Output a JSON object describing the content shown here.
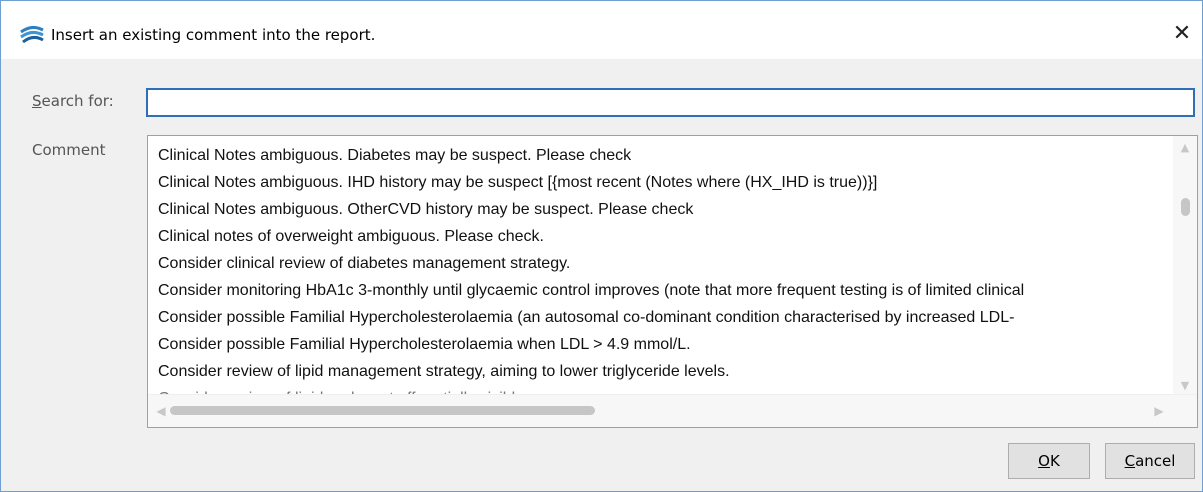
{
  "window": {
    "title": "Insert an existing comment into the report.",
    "close_glyph": "✕",
    "icon": "app-logo-icon"
  },
  "search": {
    "label_mnemonic": "S",
    "label_rest": "earch for:",
    "value": "",
    "placeholder": ""
  },
  "comment": {
    "label": "Comment",
    "items": [
      "Clinical Notes ambiguous. Diabetes may be suspect. Please check",
      "Clinical Notes ambiguous. IHD history may be suspect [{most recent (Notes where (HX_IHD is true))}]",
      "Clinical Notes ambiguous. OtherCVD history may be suspect. Please check",
      "Clinical notes of overweight ambiguous. Please check.",
      "Consider clinical review of diabetes management strategy.",
      "Consider monitoring HbA1c 3-monthly until glycaemic control improves (note that more frequent testing is of limited clinical",
      "Consider possible Familial Hypercholesterolaemia (an autosomal co-dominant condition characterised by increased LDL-",
      "Consider possible Familial Hypercholesterolaemia when LDL > 4.9 mmol/L.",
      "Consider review of lipid management strategy, aiming to lower triglyceride levels.",
      "Consider review of lipid and...  cut off partially visible row"
    ]
  },
  "scrollbars": {
    "vertical": {
      "up_icon": "▲",
      "down_icon": "▼"
    },
    "horizontal": {
      "left_icon": "◀",
      "right_icon": "▶"
    }
  },
  "buttons": {
    "ok_mnemonic": "O",
    "ok_rest": "K",
    "cancel_mnemonic": "C",
    "cancel_rest": "ancel"
  }
}
